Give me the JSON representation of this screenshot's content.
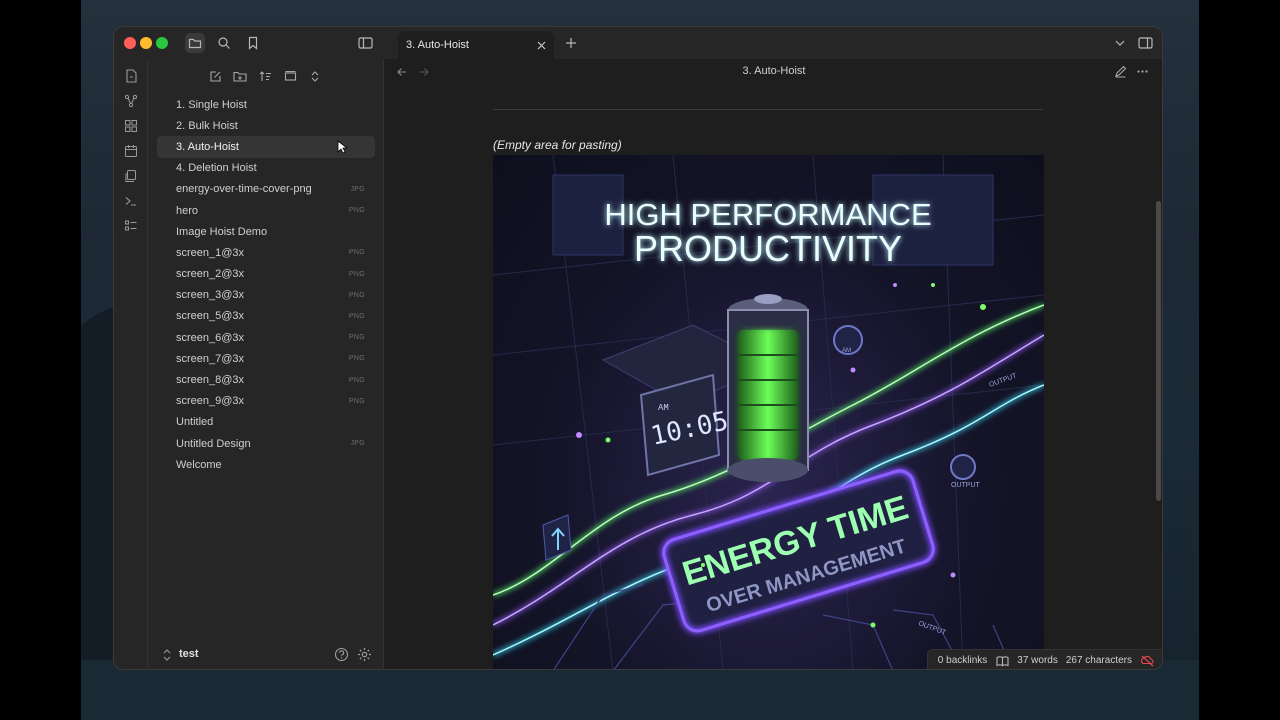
{
  "tab": {
    "title": "3. Auto-Hoist"
  },
  "view": {
    "title": "3. Auto-Hoist"
  },
  "files": [
    {
      "name": "1. Single Hoist",
      "ext": ""
    },
    {
      "name": "2. Bulk Hoist",
      "ext": ""
    },
    {
      "name": "3. Auto-Hoist",
      "ext": ""
    },
    {
      "name": "4. Deletion Hoist",
      "ext": ""
    },
    {
      "name": "energy-over-time-cover-png",
      "ext": "JPG"
    },
    {
      "name": "hero",
      "ext": "PNG"
    },
    {
      "name": "Image Hoist Demo",
      "ext": ""
    },
    {
      "name": "screen_1@3x",
      "ext": "PNG"
    },
    {
      "name": "screen_2@3x",
      "ext": "PNG"
    },
    {
      "name": "screen_3@3x",
      "ext": "PNG"
    },
    {
      "name": "screen_5@3x",
      "ext": "PNG"
    },
    {
      "name": "screen_6@3x",
      "ext": "PNG"
    },
    {
      "name": "screen_7@3x",
      "ext": "PNG"
    },
    {
      "name": "screen_8@3x",
      "ext": "PNG"
    },
    {
      "name": "screen_9@3x",
      "ext": "PNG"
    },
    {
      "name": "Untitled",
      "ext": ""
    },
    {
      "name": "Untitled Design",
      "ext": "JPG"
    },
    {
      "name": "Welcome",
      "ext": ""
    }
  ],
  "active_file_index": 2,
  "vault": {
    "name": "test"
  },
  "note": {
    "text": "(Empty area for pasting)",
    "image": {
      "headline_1": "HIGH PERFORMANCE",
      "headline_2": "PRODUCTIVITY",
      "banner_1": "ENERGY TIME",
      "banner_2": "OVER MANAGEMENT",
      "clock": "10:05",
      "clock_ampm": "AM",
      "gauge_label": "AM",
      "output_label": "OUTPUT"
    }
  },
  "status": {
    "backlinks": "0 backlinks",
    "words": "37 words",
    "characters": "267 characters"
  },
  "colors": {
    "accent_green": "#7dff6a",
    "accent_cyan": "#8ff6ff",
    "accent_purple": "#9b5cff",
    "sync_error": "#e5484d"
  }
}
